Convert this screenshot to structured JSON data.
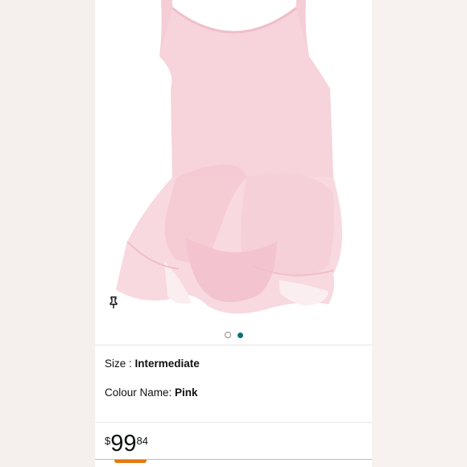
{
  "product": {
    "size_label": "Size : ",
    "size_value": "Intermediate",
    "colour_label": "Colour Name: ",
    "colour_value": "Pink",
    "price_symbol": "$",
    "price_whole": "99",
    "price_fraction": "84"
  },
  "carousel": {
    "total_images": 2,
    "active_index": 2
  },
  "icons": {
    "pin": "pin-icon"
  },
  "colors": {
    "accent_dot": "#0c7176",
    "dress": "#f7d4dc",
    "price_tab": "#e47911"
  }
}
